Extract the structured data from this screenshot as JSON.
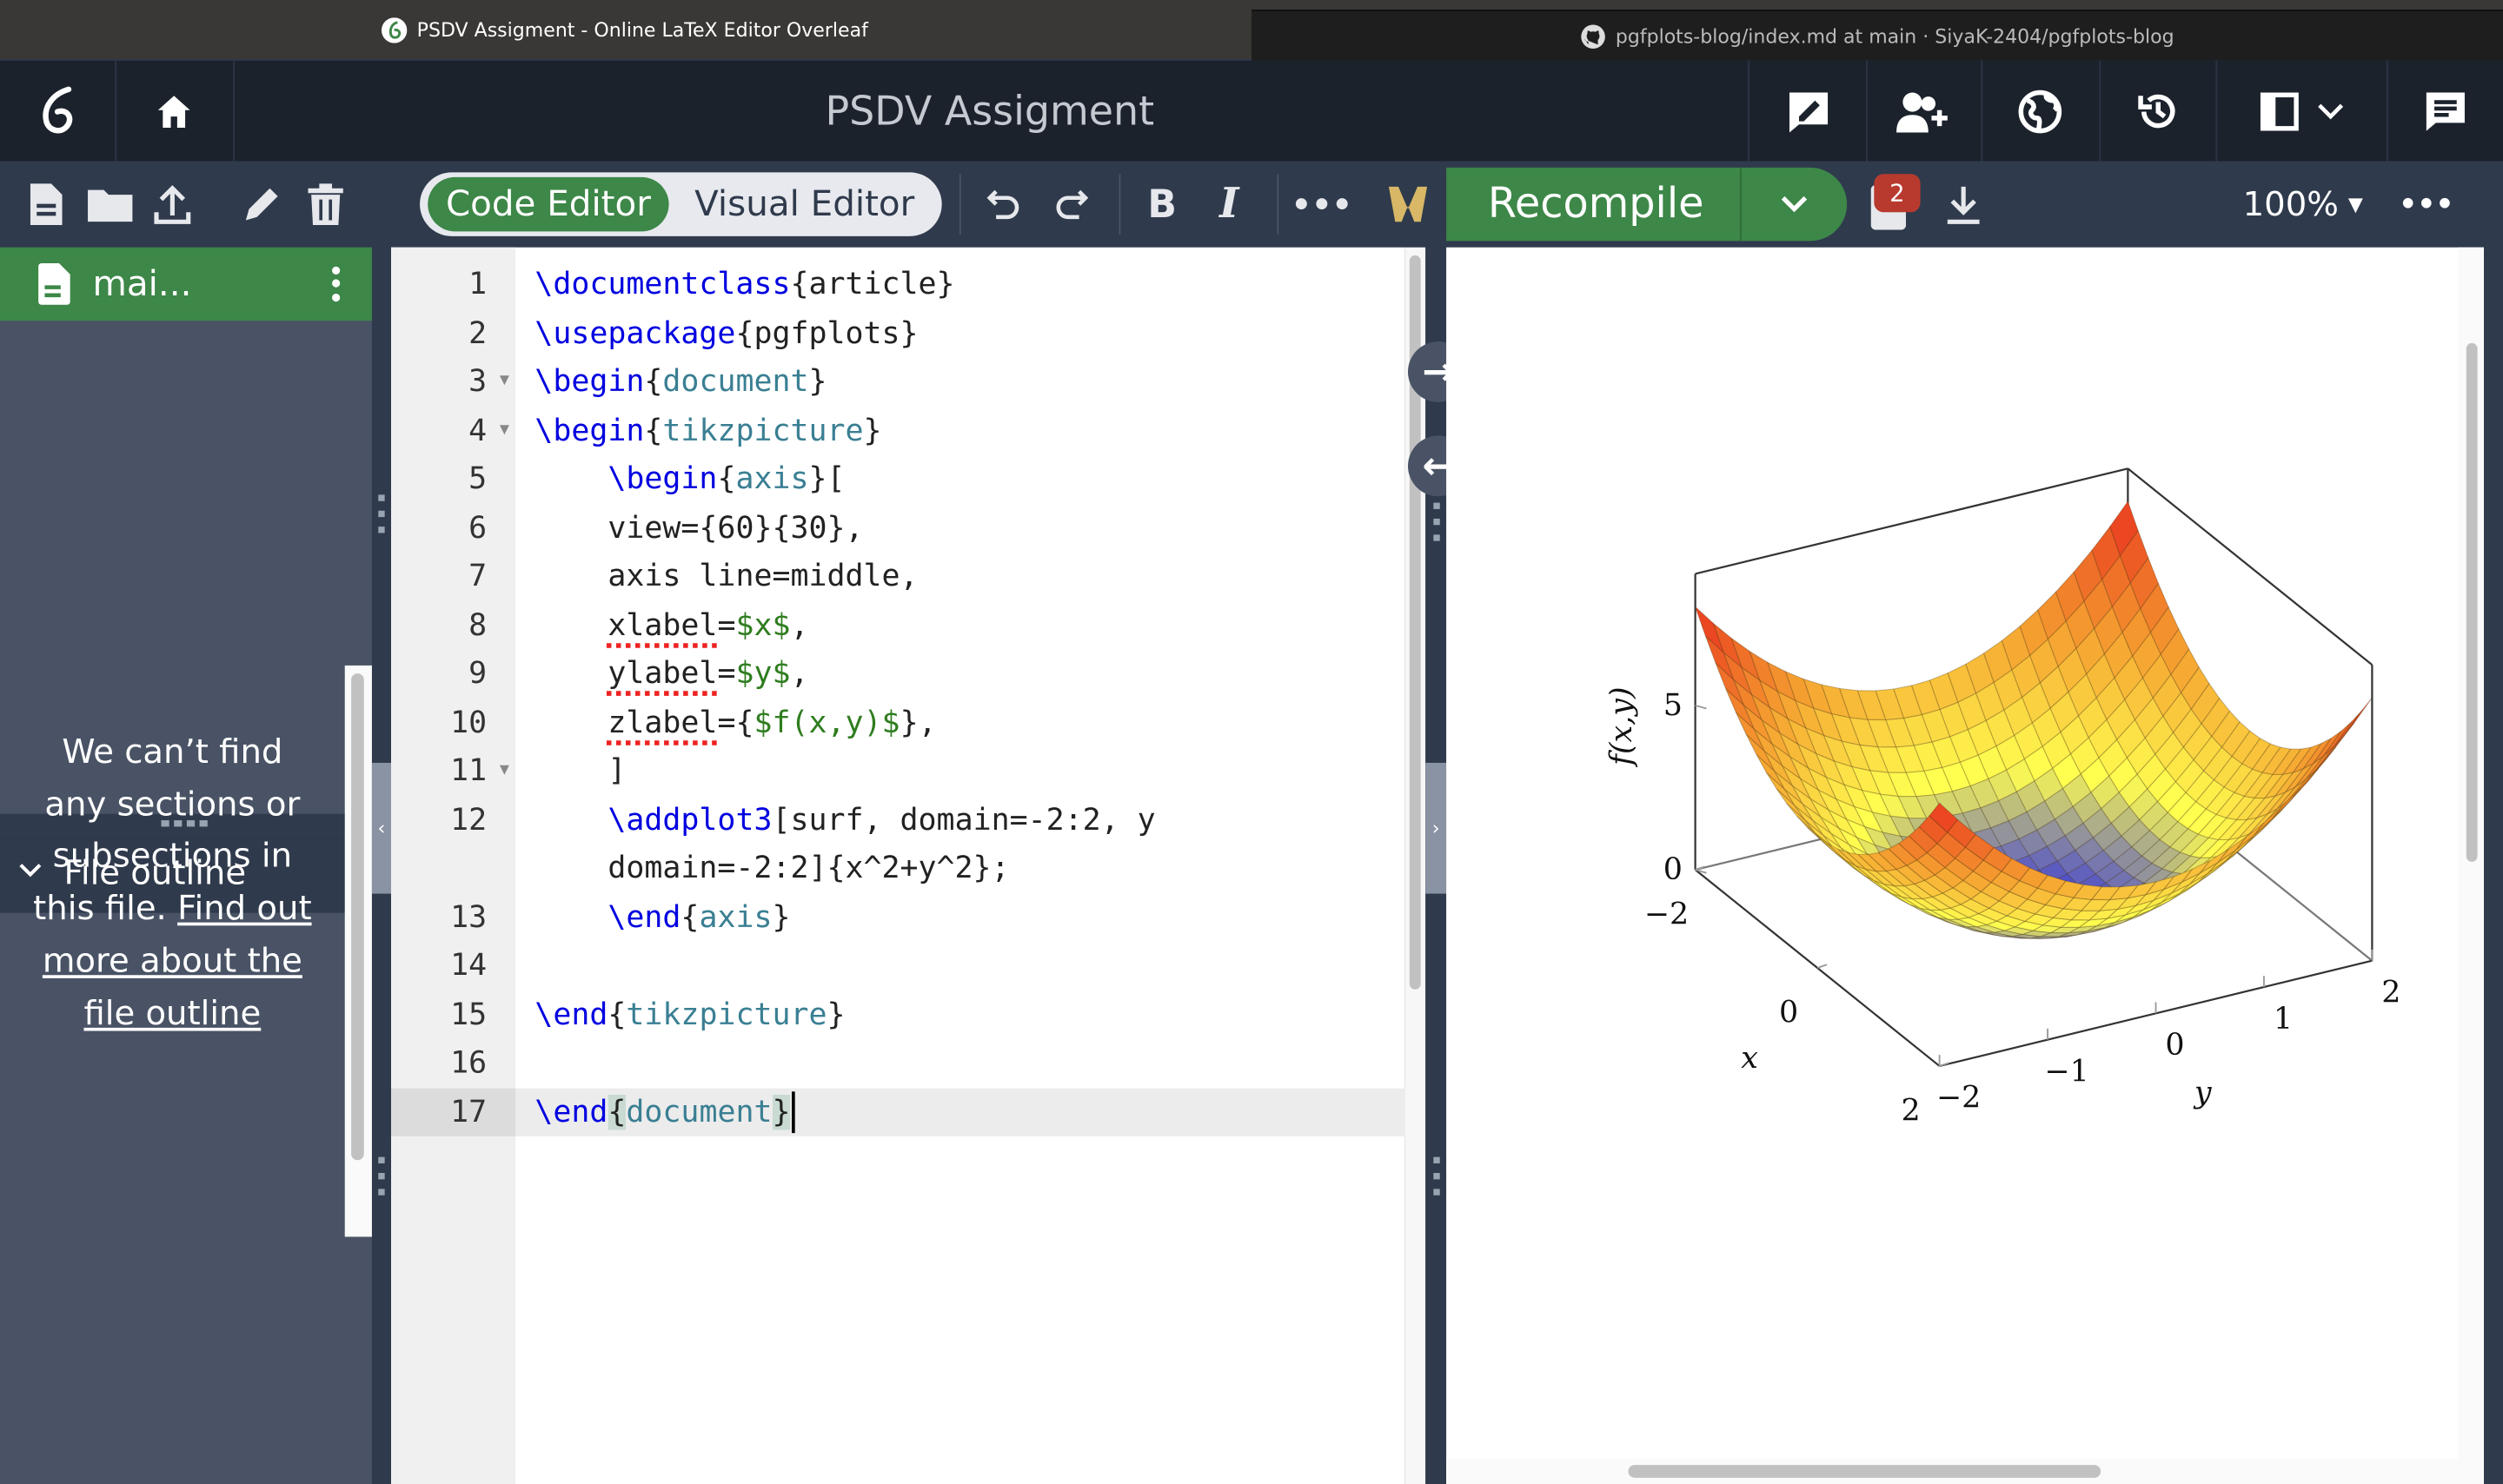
{
  "browser": {
    "tabs": [
      {
        "title": "PSDV Assigment - Online LaTeX Editor Overleaf",
        "icon": "overleaf-icon",
        "active": true
      },
      {
        "title": "pgfplots-blog/index.md at main · SiyaK-2404/pgfplots-blog",
        "icon": "github-icon",
        "active": false
      }
    ],
    "close": "×"
  },
  "header": {
    "project_title": "PSDV Assigment",
    "icons": [
      "overleaf-logo",
      "home-icon",
      "review-icon",
      "share-icon",
      "publish-globe-icon",
      "history-icon",
      "layout-icon",
      "chat-icon"
    ]
  },
  "toolbar": {
    "code_editor": "Code Editor",
    "visual_editor": "Visual Editor",
    "recompile": "Recompile",
    "log_badge": "2",
    "zoom": "100%",
    "editor_mode": "Code Editor"
  },
  "colors": {
    "green": "#3d8748",
    "header_bg": "#1b222c",
    "toolbar_bg": "#2f3a4c",
    "sidebar_bg": "#495365",
    "badge": "#b83a2f"
  },
  "sidebar": {
    "file": "mai...",
    "outline_title": "File outline",
    "outline_empty": "We can’t find any sections or subsections in this file.",
    "outline_link": "Find out more about the file outline"
  },
  "editor": {
    "lines": [
      {
        "num": "1",
        "tokens": [
          [
            "\\documentclass",
            "cmd"
          ],
          [
            "{article}",
            ""
          ]
        ]
      },
      {
        "num": "2",
        "tokens": [
          [
            "\\usepackage",
            "cmd"
          ],
          [
            "{pgfplots}",
            ""
          ]
        ]
      },
      {
        "num": "3",
        "fold": true,
        "tokens": [
          [
            "\\begin",
            "cmd"
          ],
          [
            "{",
            ""
          ],
          [
            "document",
            "env"
          ],
          [
            "}",
            ""
          ]
        ]
      },
      {
        "num": "4",
        "fold": true,
        "tokens": [
          [
            "\\begin",
            "cmd"
          ],
          [
            "{",
            ""
          ],
          [
            "tikzpicture",
            "env"
          ],
          [
            "}",
            ""
          ]
        ]
      },
      {
        "num": "5",
        "tokens": [
          [
            "    ",
            ""
          ],
          [
            "\\begin",
            "cmd"
          ],
          [
            "{",
            ""
          ],
          [
            "axis",
            "env"
          ],
          [
            "}[",
            ""
          ]
        ]
      },
      {
        "num": "6",
        "tokens": [
          [
            "    view={60}{30},",
            ""
          ]
        ]
      },
      {
        "num": "7",
        "tokens": [
          [
            "    axis line=middle,",
            ""
          ]
        ]
      },
      {
        "num": "8",
        "tokens": [
          [
            "    ",
            ""
          ],
          [
            "xlabel",
            "spell"
          ],
          [
            "=",
            ""
          ],
          [
            "$x$",
            "math"
          ],
          [
            ",",
            ""
          ]
        ]
      },
      {
        "num": "9",
        "tokens": [
          [
            "    ",
            ""
          ],
          [
            "ylabel",
            "spell"
          ],
          [
            "=",
            ""
          ],
          [
            "$y$",
            "math"
          ],
          [
            ",",
            ""
          ]
        ]
      },
      {
        "num": "10",
        "tokens": [
          [
            "    ",
            ""
          ],
          [
            "zlabel",
            "spell"
          ],
          [
            "={",
            ""
          ],
          [
            "$f(x,y)$",
            "math"
          ],
          [
            "},",
            ""
          ]
        ]
      },
      {
        "num": "11",
        "fold": true,
        "tokens": [
          [
            "    ]",
            ""
          ]
        ]
      },
      {
        "num": "12",
        "tokens": [
          [
            "    ",
            ""
          ],
          [
            "\\addplot3",
            "cmd"
          ],
          [
            "[surf, domain=-2:2, y domain=-2:2]{x^2+y^2};",
            ""
          ]
        ]
      },
      {
        "num": "13",
        "tokens": [
          [
            "    ",
            ""
          ],
          [
            "\\end",
            "cmd"
          ],
          [
            "{",
            ""
          ],
          [
            "axis",
            "env"
          ],
          [
            "}",
            ""
          ]
        ]
      },
      {
        "num": "14",
        "tokens": []
      },
      {
        "num": "15",
        "tokens": [
          [
            "\\end",
            "cmd"
          ],
          [
            "{",
            ""
          ],
          [
            "tikzpicture",
            "env"
          ],
          [
            "}",
            ""
          ]
        ]
      },
      {
        "num": "16",
        "tokens": []
      },
      {
        "num": "17",
        "active": true,
        "tokens": [
          [
            "\\end",
            "cmd"
          ],
          [
            "{",
            "mb"
          ],
          [
            "document",
            "env"
          ],
          [
            "}",
            "mb"
          ]
        ]
      }
    ]
  },
  "chart_data": {
    "type": "surface",
    "function": "x^2+y^2",
    "x_domain": [
      -2,
      2
    ],
    "y_domain": [
      -2,
      2
    ],
    "samples": 25,
    "view": [
      60,
      30
    ],
    "xlabel": "x",
    "ylabel": "y",
    "zlabel": "f(x,y)",
    "zlim": [
      0,
      9
    ],
    "x_ticks": [
      "−2",
      "0",
      "2"
    ],
    "y_ticks": [
      "−2",
      "−1",
      "0",
      "1",
      "2"
    ],
    "z_ticks": [
      "0",
      "5"
    ],
    "x_tick_values": [
      -2,
      0,
      2
    ],
    "y_tick_values": [
      -2,
      -1,
      0,
      1,
      2
    ],
    "z_tick_values": [
      0,
      5
    ],
    "colormap": [
      "#3a3ad8",
      "#ffff50",
      "#f5a030",
      "#e8301e"
    ],
    "grid": false
  }
}
